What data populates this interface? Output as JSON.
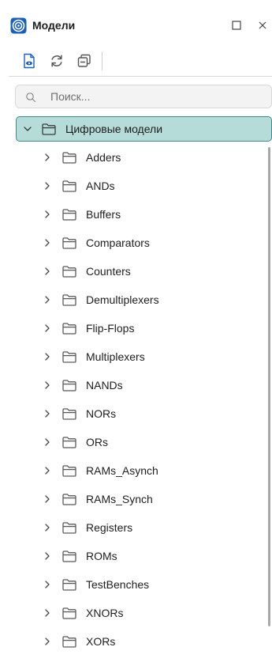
{
  "header": {
    "title": "Модели",
    "icons": {
      "app": "models-logo-icon",
      "maximize": "maximize-icon",
      "close": "close-icon"
    }
  },
  "toolbar": {
    "buttons": [
      {
        "icon": "view-document-icon"
      },
      {
        "icon": "refresh-icon"
      },
      {
        "icon": "collapse-all-icon"
      }
    ]
  },
  "search": {
    "placeholder": "Поиск...",
    "value": "",
    "icon": "search-icon"
  },
  "tree": {
    "root": {
      "label": "Цифровые модели",
      "expanded": true,
      "selected": true
    },
    "items": [
      {
        "label": "Adders"
      },
      {
        "label": "ANDs"
      },
      {
        "label": "Buffers"
      },
      {
        "label": "Comparators"
      },
      {
        "label": "Counters"
      },
      {
        "label": "Demultiplexers"
      },
      {
        "label": "Flip-Flops"
      },
      {
        "label": "Multiplexers"
      },
      {
        "label": "NANDs"
      },
      {
        "label": "NORs"
      },
      {
        "label": "ORs"
      },
      {
        "label": "RAMs_Asynch"
      },
      {
        "label": "RAMs_Synch"
      },
      {
        "label": "Registers"
      },
      {
        "label": "ROMs"
      },
      {
        "label": "TestBenches"
      },
      {
        "label": "XNORs"
      },
      {
        "label": "XORs"
      }
    ]
  },
  "colors": {
    "accent": "#1a5fb4",
    "selection_bg": "#b5dcd8",
    "selection_border": "#3f8a86",
    "folder_stroke": "#5a5a5a"
  }
}
